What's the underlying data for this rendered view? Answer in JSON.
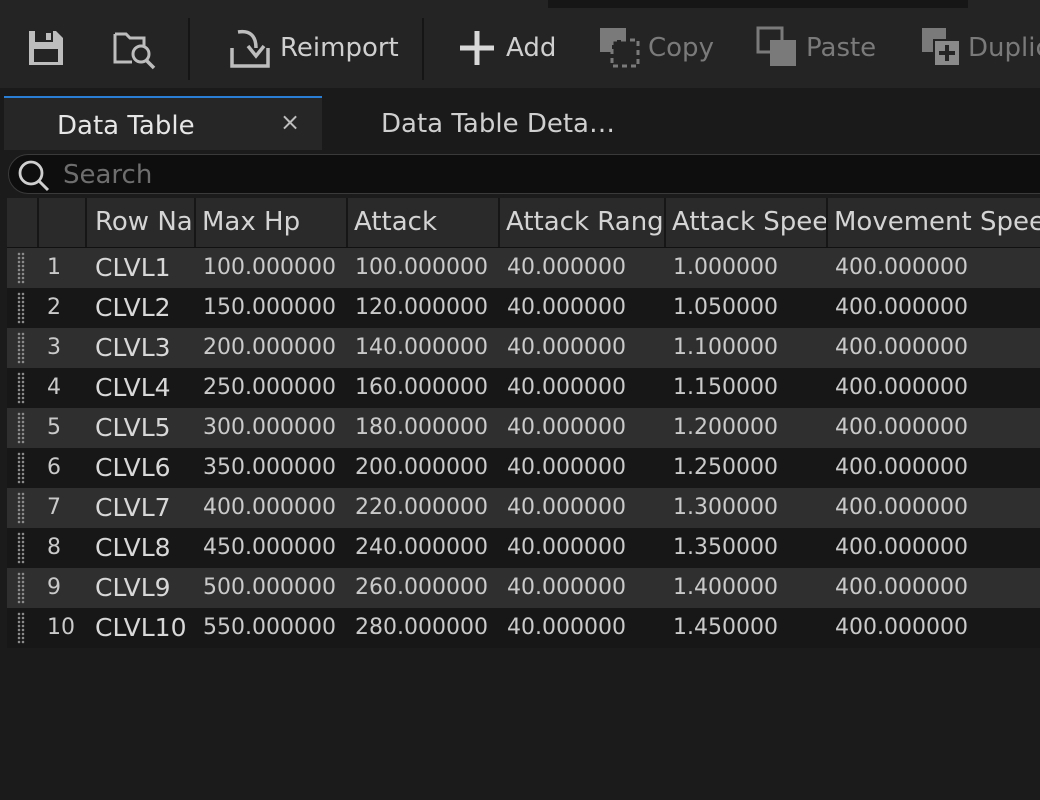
{
  "toolbar": {
    "reimport_label": "Reimport",
    "add_label": "Add",
    "copy_label": "Copy",
    "paste_label": "Paste",
    "duplicate_label": "Duplic"
  },
  "tabs": {
    "data_table": "Data Table",
    "close_glyph": "×",
    "details": "Data Table Deta…"
  },
  "search": {
    "placeholder": "Search",
    "value": ""
  },
  "table": {
    "headers": [
      "Row Nar",
      "Max Hp",
      "Attack",
      "Attack Range",
      "Attack Speed",
      "Movement Spee"
    ],
    "rows": [
      {
        "num": "1",
        "name": "CLVL1",
        "max_hp": "100.000000",
        "attack": "100.000000",
        "range": "40.000000",
        "speed": "1.000000",
        "move": "400.000000"
      },
      {
        "num": "2",
        "name": "CLVL2",
        "max_hp": "150.000000",
        "attack": "120.000000",
        "range": "40.000000",
        "speed": "1.050000",
        "move": "400.000000"
      },
      {
        "num": "3",
        "name": "CLVL3",
        "max_hp": "200.000000",
        "attack": "140.000000",
        "range": "40.000000",
        "speed": "1.100000",
        "move": "400.000000"
      },
      {
        "num": "4",
        "name": "CLVL4",
        "max_hp": "250.000000",
        "attack": "160.000000",
        "range": "40.000000",
        "speed": "1.150000",
        "move": "400.000000"
      },
      {
        "num": "5",
        "name": "CLVL5",
        "max_hp": "300.000000",
        "attack": "180.000000",
        "range": "40.000000",
        "speed": "1.200000",
        "move": "400.000000"
      },
      {
        "num": "6",
        "name": "CLVL6",
        "max_hp": "350.000000",
        "attack": "200.000000",
        "range": "40.000000",
        "speed": "1.250000",
        "move": "400.000000"
      },
      {
        "num": "7",
        "name": "CLVL7",
        "max_hp": "400.000000",
        "attack": "220.000000",
        "range": "40.000000",
        "speed": "1.300000",
        "move": "400.000000"
      },
      {
        "num": "8",
        "name": "CLVL8",
        "max_hp": "450.000000",
        "attack": "240.000000",
        "range": "40.000000",
        "speed": "1.350000",
        "move": "400.000000"
      },
      {
        "num": "9",
        "name": "CLVL9",
        "max_hp": "500.000000",
        "attack": "260.000000",
        "range": "40.000000",
        "speed": "1.400000",
        "move": "400.000000"
      },
      {
        "num": "10",
        "name": "CLVL10",
        "max_hp": "550.000000",
        "attack": "280.000000",
        "range": "40.000000",
        "speed": "1.450000",
        "move": "400.000000"
      }
    ]
  },
  "icons": {
    "save": "save-icon",
    "browse": "browse-folder-icon",
    "reimport": "reimport-icon",
    "add": "plus-icon",
    "copy": "copy-icon",
    "paste": "paste-icon",
    "duplicate": "duplicate-icon",
    "search": "search-icon",
    "grip": "drag-grip-icon"
  }
}
